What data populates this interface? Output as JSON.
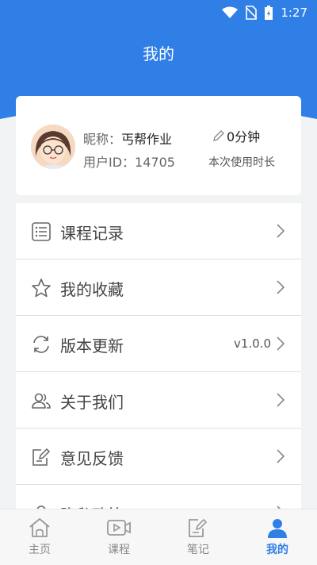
{
  "status": {
    "time": "1:27"
  },
  "header": {
    "title": "我的"
  },
  "profile": {
    "nick_label": "昵称：",
    "nick_value": "丐帮作业",
    "uid_label": "用户ID：",
    "uid_value": "14705",
    "duration_value": "0分钟",
    "duration_label": "本次使用时长"
  },
  "menu": {
    "items": [
      {
        "label": "课程记录",
        "icon": "list-icon"
      },
      {
        "label": "我的收藏",
        "icon": "star-icon"
      },
      {
        "label": "版本更新",
        "icon": "refresh-icon",
        "value": "v1.0.0"
      },
      {
        "label": "关于我们",
        "icon": "people-icon"
      },
      {
        "label": "意见反馈",
        "icon": "feedback-icon"
      },
      {
        "label": "隐私政策",
        "icon": "privacy-icon"
      }
    ]
  },
  "tabs": [
    {
      "label": "主页",
      "icon": "home-icon"
    },
    {
      "label": "课程",
      "icon": "video-icon"
    },
    {
      "label": "笔记",
      "icon": "note-icon"
    },
    {
      "label": "我的",
      "icon": "user-icon",
      "active": true
    }
  ],
  "colors": {
    "accent": "#2f7fe6",
    "inactive": "#888888"
  }
}
